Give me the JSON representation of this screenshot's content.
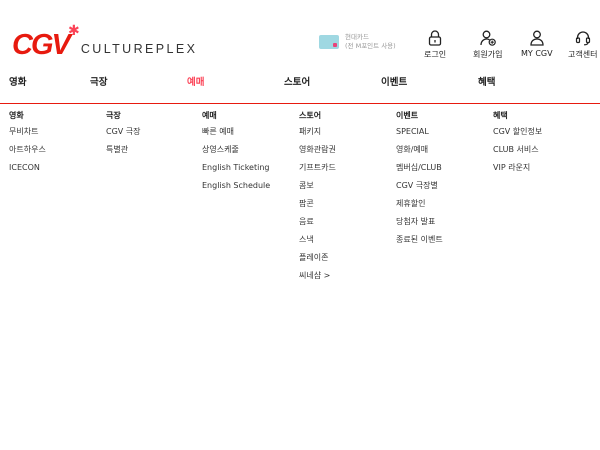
{
  "logo": {
    "mark": "CGV",
    "sub": "CULTUREPLEX"
  },
  "promo": {
    "line1": "현대카드",
    "line2": "(전 M포인트 사용)"
  },
  "util": {
    "login": "로그인",
    "join": "회원가입",
    "mycgv": "MY CGV",
    "support": "고객센터"
  },
  "gnb": [
    "영화",
    "극장",
    "예매",
    "스토어",
    "이벤트",
    "혜택"
  ],
  "columns": [
    {
      "title": "영화",
      "links": [
        "무비차트",
        "아트하우스",
        "ICECON"
      ]
    },
    {
      "title": "극장",
      "links": [
        "CGV 극장",
        "특별관"
      ]
    },
    {
      "title": "예매",
      "links": [
        "빠른 예매",
        "상영스케줄",
        "English Ticketing",
        "English Schedule"
      ]
    },
    {
      "title": "스토어",
      "links": [
        "패키지",
        "영화관람권",
        "기프트카드",
        "콤보",
        "팝콘",
        "음료",
        "스낵",
        "플레이존",
        "씨네샵 >"
      ]
    },
    {
      "title": "이벤트",
      "links": [
        "SPECIAL",
        "영화/예매",
        "멤버십/CLUB",
        "CGV 극장별",
        "제휴할인",
        "당첨자 발표",
        "종료된 이벤트"
      ]
    },
    {
      "title": "혜택",
      "links": [
        "CGV 할인정보",
        "CLUB 서비스",
        "VIP 라운지"
      ]
    }
  ]
}
